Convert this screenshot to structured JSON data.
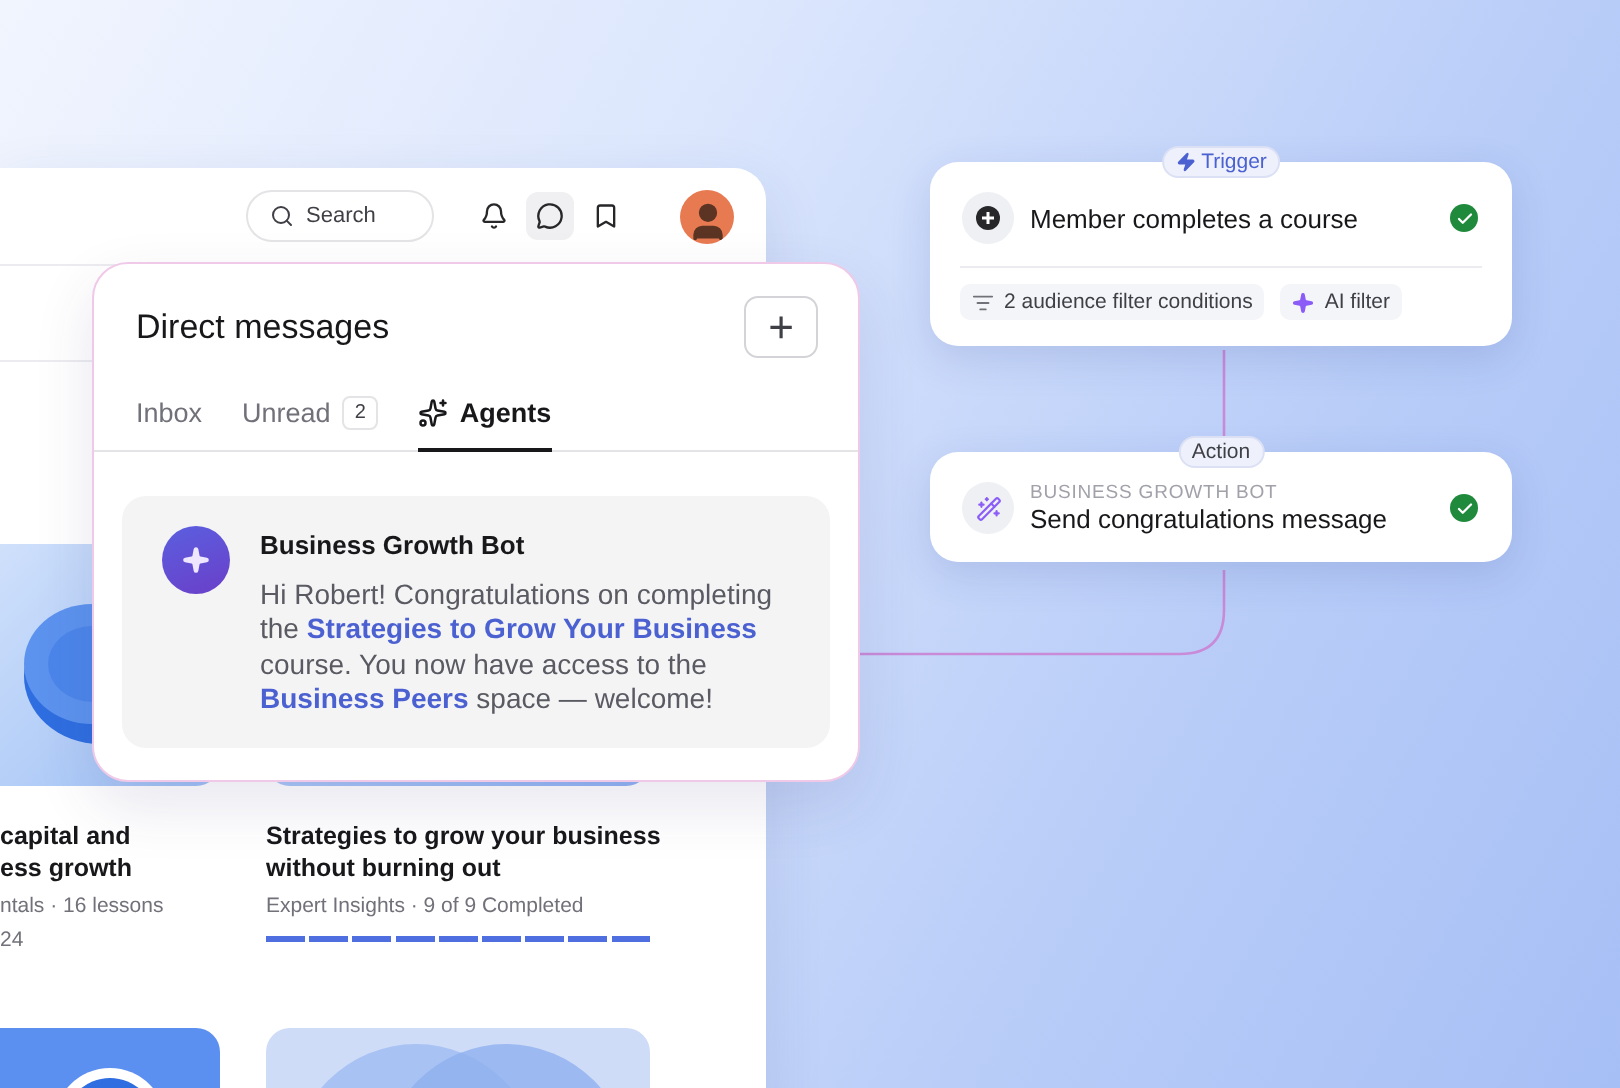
{
  "app_header": {
    "search": {
      "placeholder": "Search"
    },
    "icons": [
      {
        "kind": "bell",
        "selected": false
      },
      {
        "kind": "chat",
        "selected": true
      },
      {
        "kind": "bookmark",
        "selected": false
      }
    ]
  },
  "courses": [
    {
      "title_lines": [
        "capital and",
        "ess growth"
      ],
      "meta": "ntals · 16 lessons",
      "meta_extra": "24"
    },
    {
      "title_lines": [
        "Strategies to grow your business",
        "without burning out"
      ],
      "meta": "Expert Insights · 9 of 9 Completed",
      "progress": {
        "level": 1
      }
    }
  ],
  "direct_messages": {
    "title": "Direct messages",
    "new_button": "+",
    "tabs": [
      {
        "label": "Inbox",
        "kind": "text",
        "selected": false
      },
      {
        "label": "Unread",
        "kind": "count",
        "badge": "2",
        "selected": false
      },
      {
        "label": "Agents",
        "kind": "icon",
        "selected": true
      }
    ],
    "message": {
      "sender": "Business Growth Bot",
      "text": "Hi Robert! Congratulations on completing the **Strategies to Grow Your Business** course. You now have access to the **Business Peers** space — welcome!"
    }
  },
  "workflow": {
    "trigger": {
      "badge": "Trigger",
      "title": "Member completes a course",
      "done": true,
      "chips": [
        {
          "kind": "filter",
          "label": "2 audience filter conditions"
        },
        {
          "kind": "ai",
          "label": "AI filter"
        }
      ]
    },
    "action": {
      "badge": "Action",
      "overline": "BUSINESS GROWTH BOT",
      "title": "Send congratulations message",
      "done": true
    }
  }
}
